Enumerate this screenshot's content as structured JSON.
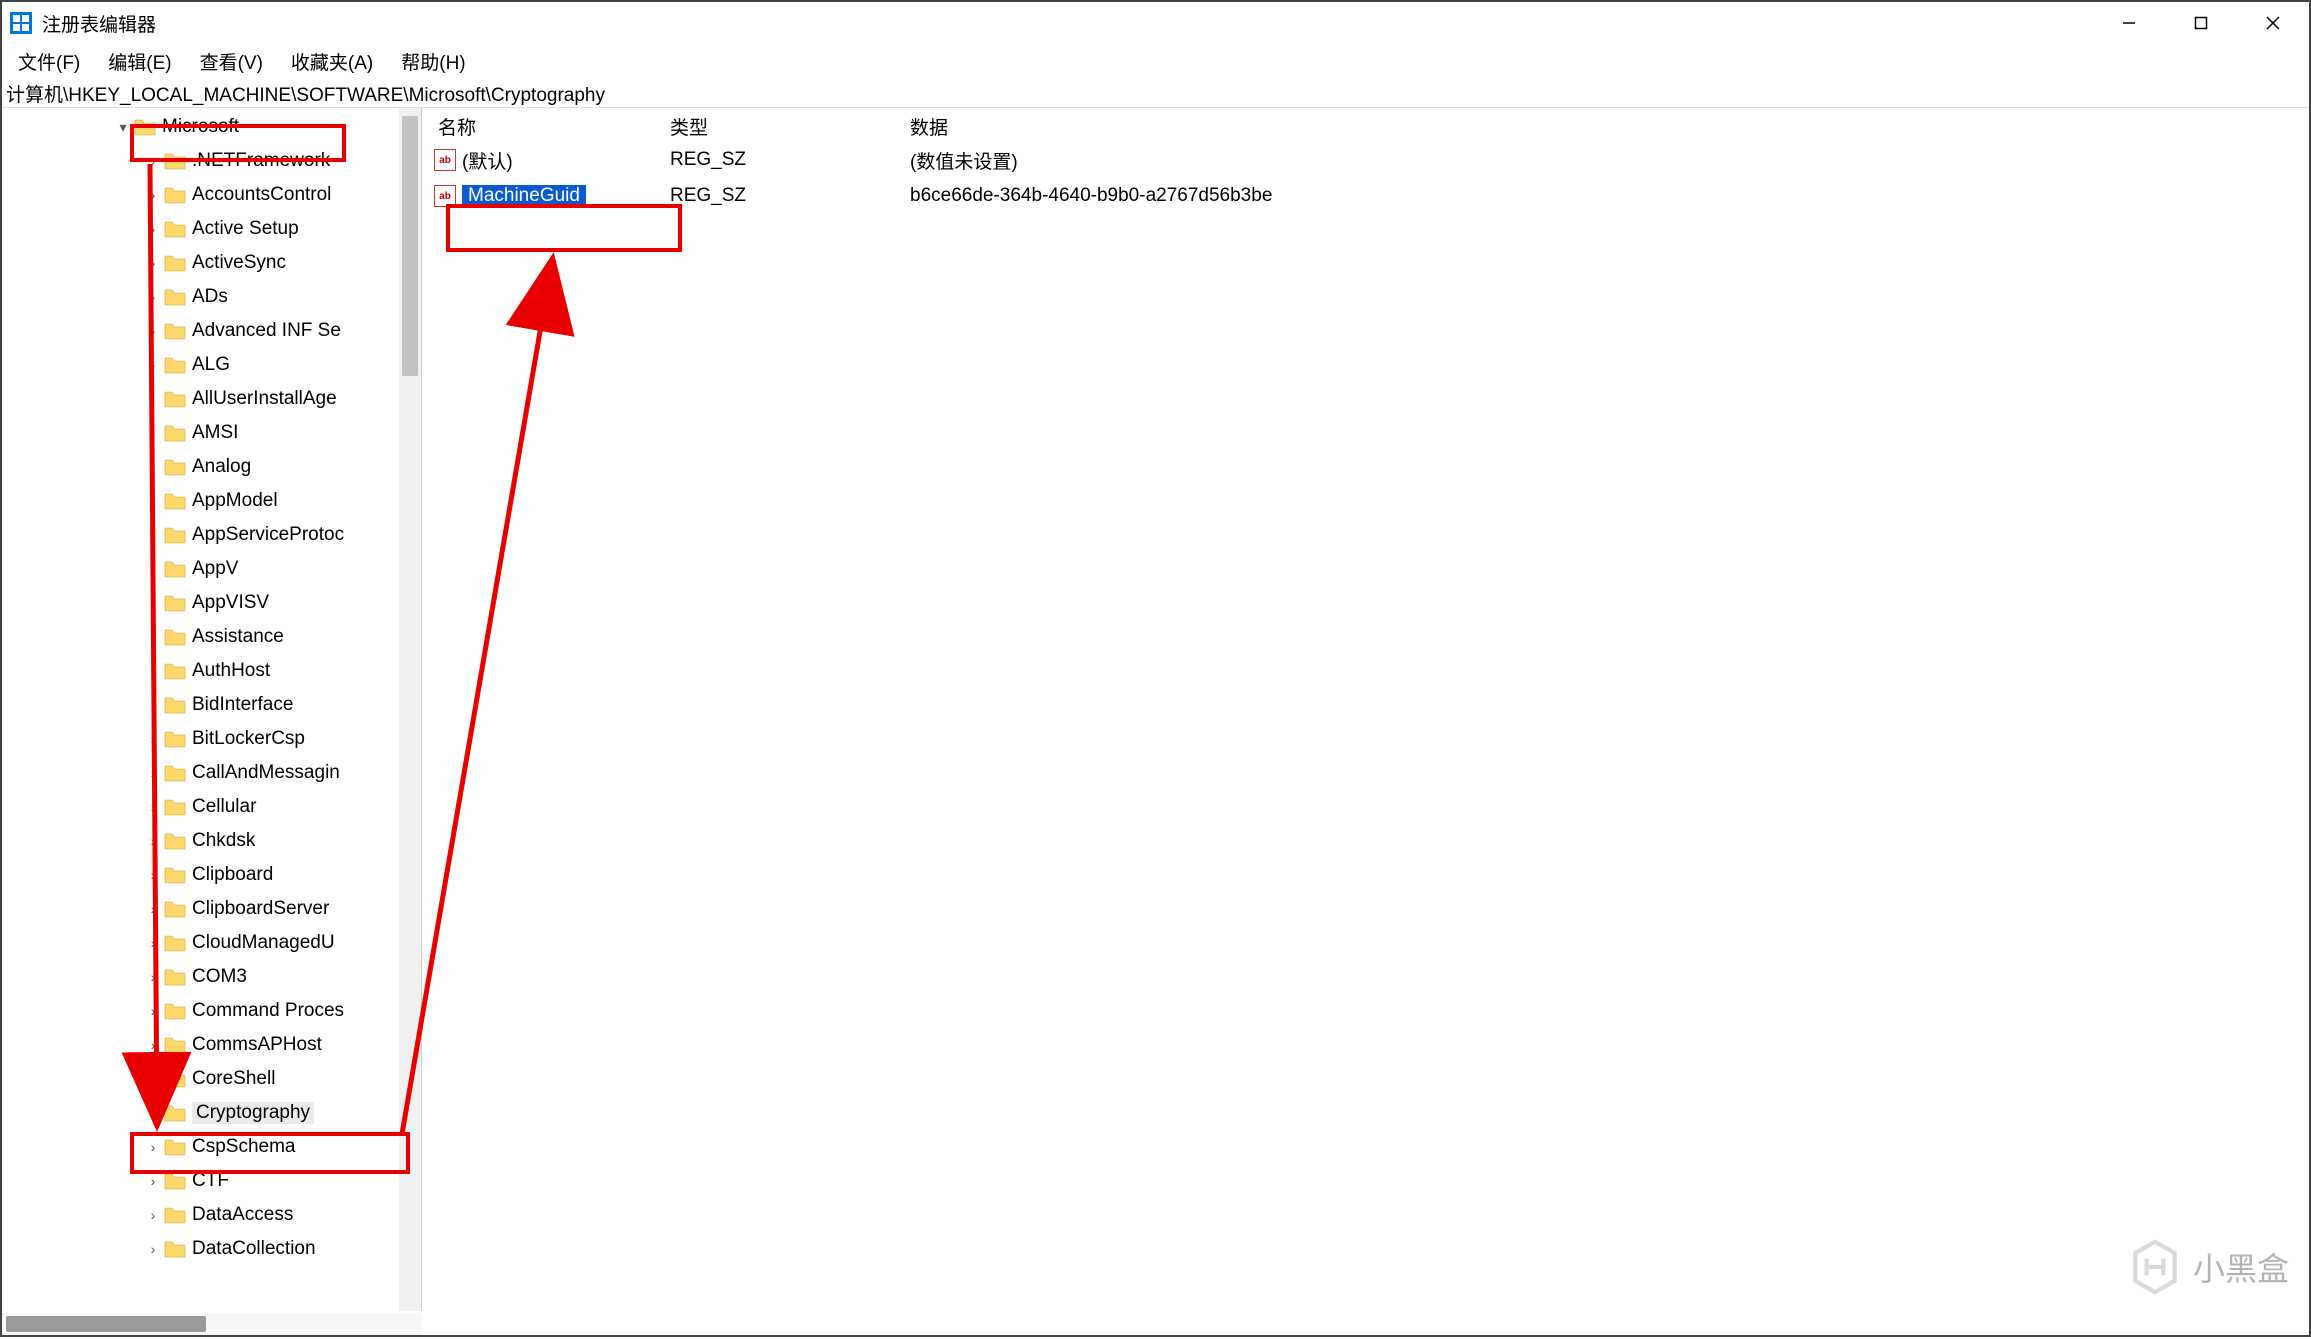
{
  "window": {
    "title": "注册表编辑器"
  },
  "menu": {
    "file": "文件(F)",
    "edit": "编辑(E)",
    "view": "查看(V)",
    "favorites": "收藏夹(A)",
    "help": "帮助(H)"
  },
  "address": "计算机\\HKEY_LOCAL_MACHINE\\SOFTWARE\\Microsoft\\Cryptography",
  "tree": {
    "root": "Microsoft",
    "items": [
      ".NETFramework",
      "AccountsControl",
      "Active Setup",
      "ActiveSync",
      "ADs",
      "Advanced INF Se",
      "ALG",
      "AllUserInstallAge",
      "AMSI",
      "Analog",
      "AppModel",
      "AppServiceProtoc",
      "AppV",
      "AppVISV",
      "Assistance",
      "AuthHost",
      "BidInterface",
      "BitLockerCsp",
      "CallAndMessagin",
      "Cellular",
      "Chkdsk",
      "Clipboard",
      "ClipboardServer",
      "CloudManagedU",
      "COM3",
      "Command Proces",
      "CommsAPHost",
      "CoreShell",
      "Cryptography",
      "CspSchema",
      "CTF",
      "DataAccess",
      "DataCollection"
    ],
    "no_expander": [
      "AllUserInstallAge",
      "AppVISV"
    ],
    "selected": "Cryptography"
  },
  "values": {
    "headers": {
      "name": "名称",
      "type": "类型",
      "data": "数据"
    },
    "rows": [
      {
        "name": "(默认)",
        "type": "REG_SZ",
        "data": "(数值未设置)",
        "selected": false
      },
      {
        "name": "MachineGuid",
        "type": "REG_SZ",
        "data": "b6ce66de-364b-4640-b9b0-a2767d56b3be",
        "selected": true
      }
    ]
  },
  "watermark": "小黑盒"
}
